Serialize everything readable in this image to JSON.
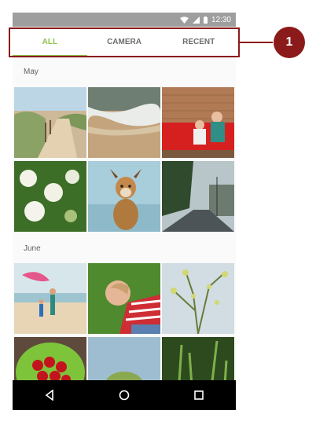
{
  "status_bar": {
    "time": "12:30",
    "icons": [
      "wifi-icon",
      "signal-icon",
      "battery-icon"
    ]
  },
  "tabs": [
    {
      "label": "ALL",
      "active": true
    },
    {
      "label": "CAMERA",
      "active": false
    },
    {
      "label": "RECENT",
      "active": false
    }
  ],
  "sections": [
    {
      "label": "May",
      "photos": [
        "beach-path",
        "ocean-waves",
        "mother-child-reading",
        "white-flowers",
        "dog",
        "city-street"
      ]
    },
    {
      "label": "June",
      "photos": [
        "beach-kite-children",
        "child-lying-grass",
        "blossom-branches",
        "cherries-bowl",
        "tree-sky",
        "green-plants"
      ]
    }
  ],
  "nav_bar": {
    "icons": [
      "back-icon",
      "home-icon",
      "recents-icon"
    ]
  },
  "annotation": {
    "callout_number": "1"
  },
  "colors": {
    "accent": "#8bc34a",
    "annotation": "#8b1a1a",
    "status_bar": "#9e9e9e"
  }
}
